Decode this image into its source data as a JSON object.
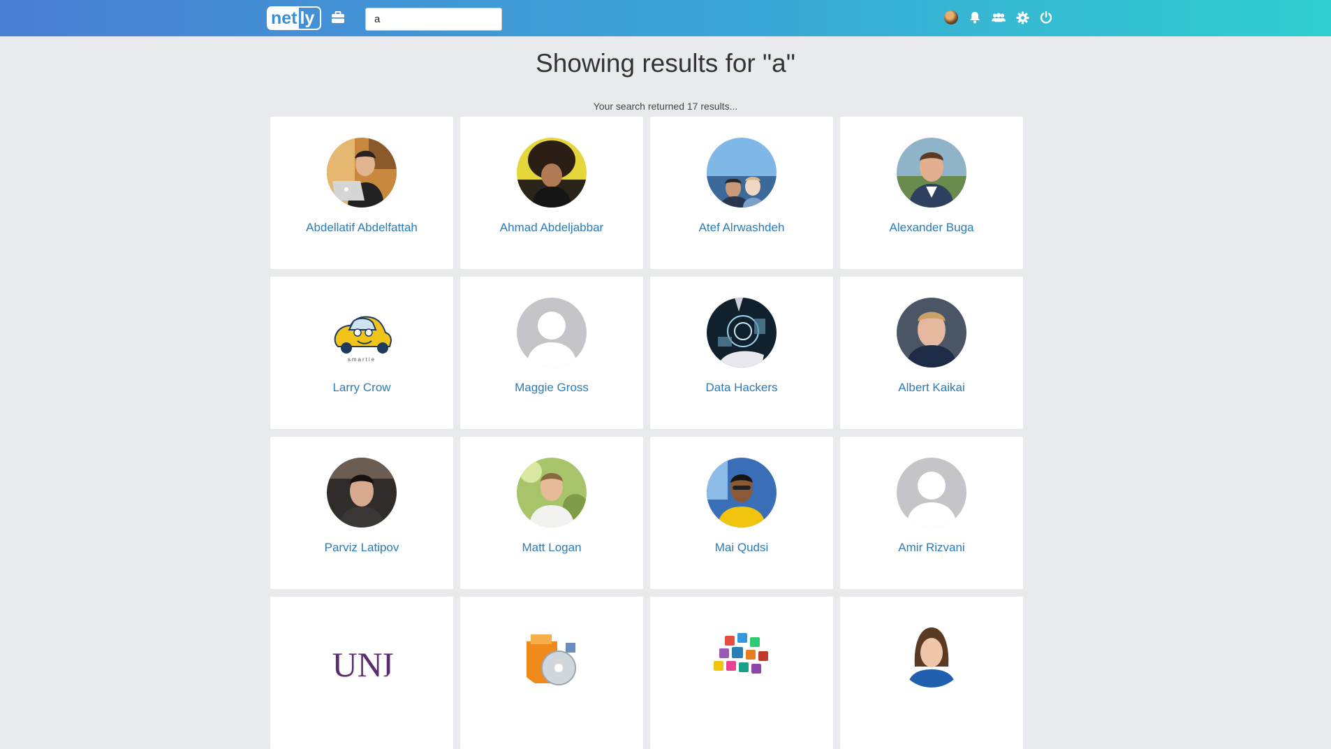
{
  "header": {
    "logo_part1": "net",
    "logo_part2": "ly",
    "search_value": "a"
  },
  "page": {
    "title": "Showing results for \"a\"",
    "summary": "Your search returned 17 results..."
  },
  "results": [
    {
      "name": "Abdellatif Abdelfattah",
      "avatar": "photo-laptop"
    },
    {
      "name": "Ahmad Abdeljabbar",
      "avatar": "photo-curly-hair"
    },
    {
      "name": "Atef Alrwashdeh",
      "avatar": "photo-sky-selfie"
    },
    {
      "name": "Alexander Buga",
      "avatar": "photo-outdoor-smile"
    },
    {
      "name": "Larry Crow",
      "avatar": "car-logo",
      "logo_text": "smartie"
    },
    {
      "name": "Maggie Gross",
      "avatar": "default-user"
    },
    {
      "name": "Data Hackers",
      "avatar": "photo-tech-hand"
    },
    {
      "name": "Albert Kaikai",
      "avatar": "photo-portrait"
    },
    {
      "name": "Parviz Latipov",
      "avatar": "photo-car-selfie"
    },
    {
      "name": "Matt Logan",
      "avatar": "photo-green-background"
    },
    {
      "name": "Mai Qudsi",
      "avatar": "photo-glasses"
    },
    {
      "name": "Amir Rizvani",
      "avatar": "default-user"
    },
    {
      "name": "",
      "avatar": "logo-letters",
      "logo_text": "UNI"
    },
    {
      "name": "",
      "avatar": "dvd-box-icon"
    },
    {
      "name": "",
      "avatar": "app-cubes-icon"
    },
    {
      "name": "",
      "avatar": "photo-woman"
    }
  ],
  "colors": {
    "header_gradient": [
      "#4a7fd4",
      "#3aa6d6",
      "#2fcfcf"
    ],
    "link": "#2b7bb9",
    "background": "#e9eaed"
  },
  "icons": [
    "briefcase-icon",
    "bell-icon",
    "friends-icon",
    "gear-icon",
    "power-icon"
  ]
}
